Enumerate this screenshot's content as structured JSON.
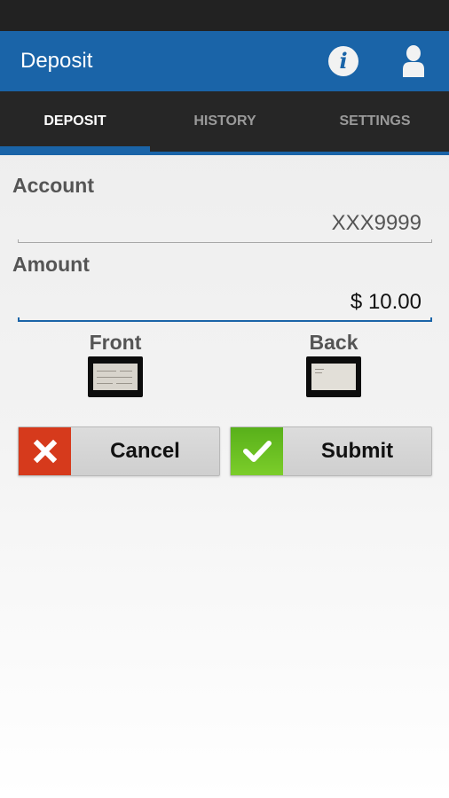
{
  "header": {
    "title": "Deposit",
    "info_icon_glyph": "i"
  },
  "tabs": [
    {
      "label": "DEPOSIT",
      "active": true
    },
    {
      "label": "HISTORY",
      "active": false
    },
    {
      "label": "SETTINGS",
      "active": false
    }
  ],
  "form": {
    "account": {
      "label": "Account",
      "value": "XXX9999"
    },
    "amount": {
      "label": "Amount",
      "value": "$ 10.00"
    }
  },
  "check_images": {
    "front_label": "Front",
    "back_label": "Back"
  },
  "buttons": {
    "cancel_label": "Cancel",
    "submit_label": "Submit"
  },
  "icons": {
    "info": "info-icon",
    "user": "user-icon",
    "cancel": "close-icon",
    "submit": "checkmark-icon"
  },
  "colors": {
    "brand": "#1a64a8",
    "cancel_accent": "#d63a1c",
    "submit_accent": "#6cc11f",
    "status_bar": "#222222",
    "tab_bar": "#262626"
  }
}
